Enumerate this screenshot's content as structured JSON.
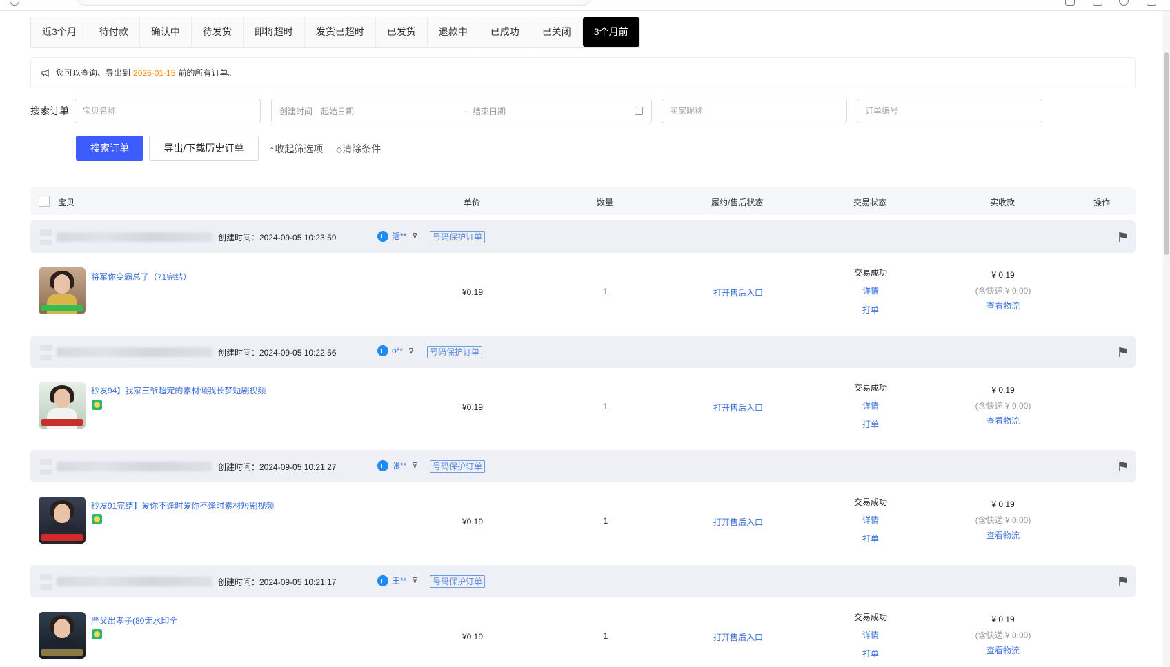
{
  "tabs": [
    {
      "label": "近3个月",
      "active": false
    },
    {
      "label": "待付款",
      "active": false
    },
    {
      "label": "确认中",
      "active": false
    },
    {
      "label": "待发货",
      "active": false
    },
    {
      "label": "即将超时",
      "active": false
    },
    {
      "label": "发货已超时",
      "active": false
    },
    {
      "label": "已发货",
      "active": false
    },
    {
      "label": "退款中",
      "active": false
    },
    {
      "label": "已成功",
      "active": false
    },
    {
      "label": "已关闭",
      "active": false
    },
    {
      "label": "3个月前",
      "active": true
    }
  ],
  "notice": {
    "prefix": "您可以查询、导出到",
    "date": "2026-01-15",
    "suffix": "前的所有订单。"
  },
  "search": {
    "label": "搜索订单",
    "product_placeholder": "宝贝名称",
    "created_label": "创建时间",
    "start_placeholder": "起始日期",
    "range_sep": "-",
    "end_placeholder": "结束日期",
    "buyer_placeholder": "买家昵称",
    "order_no_placeholder": "订单编号",
    "search_button": "搜索订单",
    "export_button": "导出/下载历史订单",
    "collapse_label": "收起筛选项",
    "clear_label": "清除条件"
  },
  "table_header": {
    "product": "宝贝",
    "price": "单价",
    "quantity": "数量",
    "after_sale": "履约/售后状态",
    "trade_status": "交易状态",
    "received": "实收款",
    "action": "操作"
  },
  "orders": [
    {
      "created": "创建时间：2024-09-05 10:23:59",
      "buyer": "活**",
      "tag": "号码保护订单",
      "title": "将军你变霸总了（71完结）",
      "badge": false,
      "price": "¥0.19",
      "quantity": "1",
      "after_sale": "打开售后入口",
      "status": "交易成功",
      "detail": "详情",
      "print": "打单",
      "amount": "¥ 0.19",
      "shipping": "(含快递:¥ 0.00)",
      "logistics": "查看物流"
    },
    {
      "created": "创建时间：2024-09-05 10:22:56",
      "buyer": "o**",
      "tag": "号码保护订单",
      "title": "秒发94】我家三爷超宠的素材倾我长梦短剧视频",
      "badge": true,
      "price": "¥0.19",
      "quantity": "1",
      "after_sale": "打开售后入口",
      "status": "交易成功",
      "detail": "详情",
      "print": "打单",
      "amount": "¥ 0.19",
      "shipping": "(含快递:¥ 0.00)",
      "logistics": "查看物流"
    },
    {
      "created": "创建时间：2024-09-05 10:21:27",
      "buyer": "张**",
      "tag": "号码保护订单",
      "title": "秒发91完结】爱你不逢时爱你不逢时素材短剧视频",
      "badge": true,
      "price": "¥0.19",
      "quantity": "1",
      "after_sale": "打开售后入口",
      "status": "交易成功",
      "detail": "详情",
      "print": "打单",
      "amount": "¥ 0.19",
      "shipping": "(含快递:¥ 0.00)",
      "logistics": "查看物流"
    },
    {
      "created": "创建时间：2024-09-05 10:21:17",
      "buyer": "王**",
      "tag": "号码保护订单",
      "title": "严父出孝子(80无水印全",
      "badge": true,
      "price": "¥0.19",
      "quantity": "1",
      "after_sale": "打开售后入口",
      "status": "交易成功",
      "detail": "详情",
      "print": "打单",
      "amount": "¥ 0.19",
      "shipping": "(含快递:¥ 0.00)",
      "logistics": "查看物流"
    }
  ],
  "colors": {
    "primary": "#3d5cfe",
    "link": "#3a6fd8",
    "accent_date": "#ff8a00",
    "order_head_bg": "#eef0f6"
  }
}
